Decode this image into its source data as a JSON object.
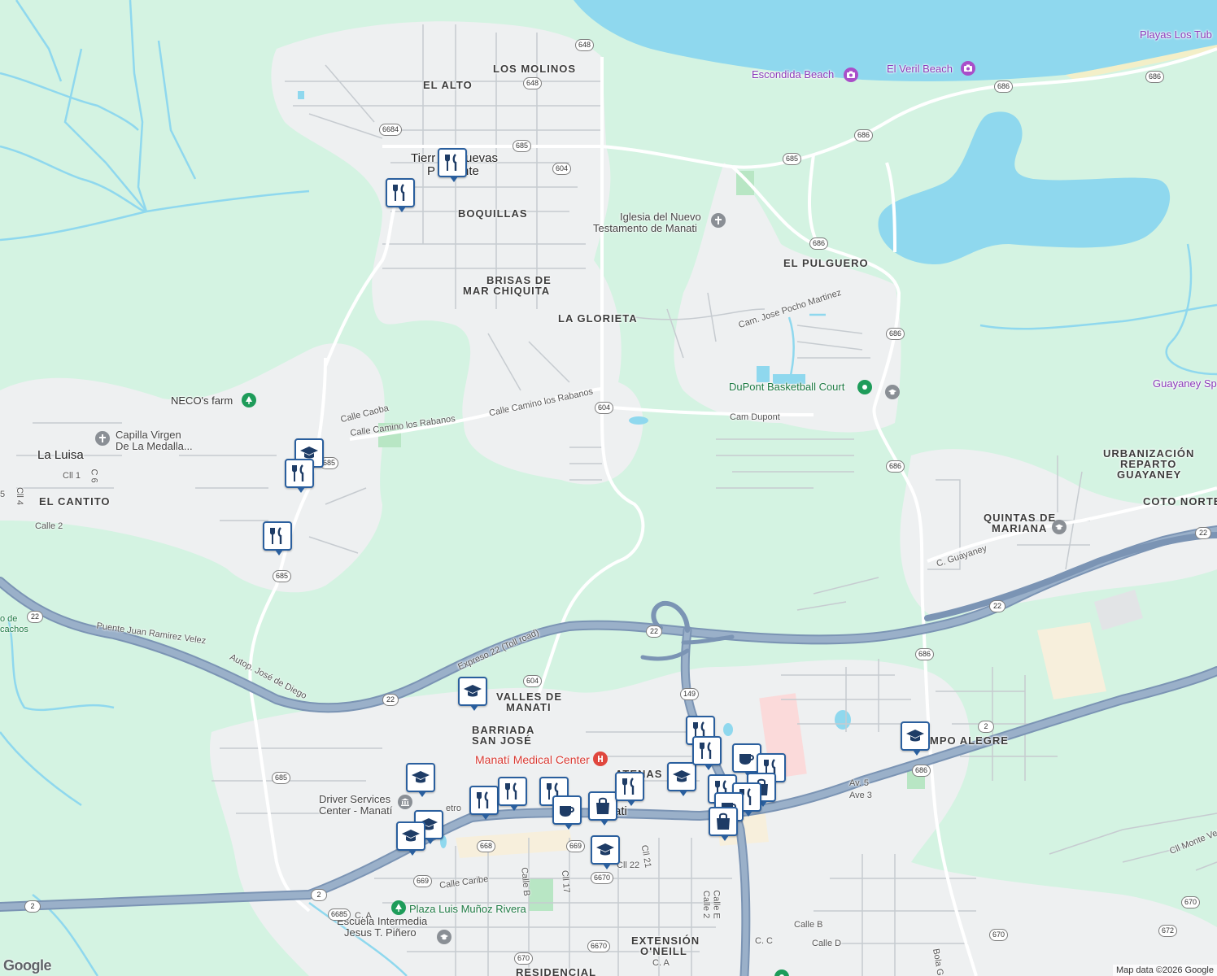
{
  "map": {
    "attribution": "Map data ©2026 Google",
    "logo": "Google",
    "areas": {
      "los_molinos": "LOS MOLINOS",
      "el_alto": "EL ALTO",
      "tierras_nuevas_1": "Tierr",
      "tierras_nuevas_2": "uevas",
      "tierras_nuevas_3": "P",
      "tierras_nuevas_4": "nte",
      "boquillas": "BOQUILLAS",
      "brisas_1": "BRISAS DE",
      "brisas_2": "MAR CHIQUITA",
      "la_glorieta": "LA GLORIETA",
      "el_pulguero": "EL PULGUERO",
      "la_luisa": "La Luisa",
      "el_cantito": "EL CANTITO",
      "urb_1": "URBANIZACIÓN",
      "urb_2": "REPARTO",
      "urb_3": "GUAYANEY",
      "coto_norte": "COTO NORTE",
      "quintas_1": "QUINTAS DE",
      "quintas_2": "MARIANA",
      "valles_1": "VALLES DE",
      "valles_2": "MANATI",
      "barriada_1": "BARRIADA",
      "barriada_2": "SAN JOSÉ",
      "atenas": "ATENAS",
      "manati": "ati",
      "campo_alegre": "MPO ALEGRE",
      "extension_1": "EXTENSIÓN",
      "extension_2": "O'NEILL",
      "residencial": "RESIDENCIAL"
    },
    "pois": {
      "playas_los_tub": "Playas Los Tub",
      "escondida_beach": "Escondida Beach",
      "el_veril_beach": "El Veril Beach",
      "iglesia_1": "Iglesia del Nuevo",
      "iglesia_2": "Testamento de Manati",
      "dupont_court": "DuPont Basketball Court",
      "guayaney": "Guayaney Sp",
      "necos_farm": "NECO's farm",
      "capilla_1": "Capilla Virgen",
      "capilla_2": "De La Medalla...",
      "medical_center": "Manatí Medical Center",
      "driver_1": "Driver Services",
      "driver_2": "Center - Manatí",
      "plaza": "Plaza Luis Muñoz Rivera",
      "escuela_1": "Escuela Intermedia",
      "escuela_2": "Jesus T. Piñero"
    },
    "streets": {
      "calle_caoba": "Calle Caoba",
      "camino_rabanos_1": "Calle Camino los Rabanos",
      "camino_rabanos_2": "Calle Camino los Rabanos",
      "cam_pocho": "Cam. Jose Pocho Martinez",
      "cam_dupont": "Cam Dupont",
      "cll1": "Cll 1",
      "c6": "C 6",
      "cll4": "Cll 4",
      "c5": "5",
      "calle2": "Calle 2",
      "c_guayaney": "C. Guayaney",
      "puente": "Puente Juan Ramirez Velez",
      "autop": "Autop. José de Diego",
      "expreso": "Expreso 22 (Toll road)",
      "av5": "Av. 5",
      "ave3": "Ave 3",
      "calle_caribe": "Calle Caribe",
      "calle_b": "Calle B",
      "cll17": "Cll 17",
      "cll21": "Cll 21",
      "cll22": "Cll 22",
      "calle_e": "Calle E",
      "calle_2b": "Calle 2",
      "calle_b2": "Calle B",
      "c_c": "C. C",
      "calle_d": "Calle D",
      "c_a1": "C. A",
      "c_a2": "C. A",
      "cll_monte": "Cll Monte Ver",
      "bola": "Bola G",
      "metro": "etro",
      "cachos": "cachos",
      "o_de": "o de"
    },
    "shields": [
      "648",
      "648",
      "6684",
      "685",
      "604",
      "685",
      "686",
      "686",
      "686",
      "686",
      "685",
      "604",
      "685",
      "22",
      "22",
      "22",
      "22",
      "22",
      "604",
      "149",
      "686",
      "686",
      "685",
      "668",
      "669",
      "669",
      "6670",
      "670",
      "6685",
      "670",
      "2",
      "2",
      "2",
      "670",
      "672",
      "6670"
    ]
  }
}
